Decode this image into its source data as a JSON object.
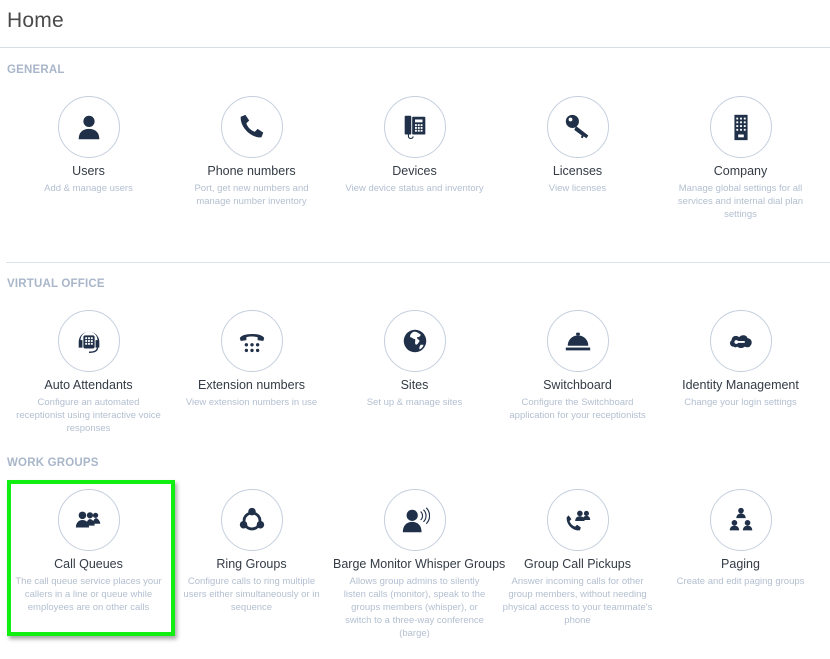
{
  "header": {
    "title": "Home"
  },
  "sections": [
    {
      "label": "GENERAL",
      "items": [
        {
          "title": "Users",
          "description": "Add & manage users",
          "icon": "user-icon"
        },
        {
          "title": "Phone numbers",
          "description": "Port, get new numbers and manage number inventory",
          "icon": "phone-icon"
        },
        {
          "title": "Devices",
          "description": "View device status and inventory",
          "icon": "desk-phone-icon"
        },
        {
          "title": "Licenses",
          "description": "View licenses",
          "icon": "key-icon"
        },
        {
          "title": "Company",
          "description": "Manage global settings for all services and internal dial plan settings",
          "icon": "building-icon"
        }
      ]
    },
    {
      "label": "VIRTUAL OFFICE",
      "items": [
        {
          "title": "Auto Attendants",
          "description": "Configure an automated receptionist using interactive voice responses",
          "icon": "headset-icon"
        },
        {
          "title": "Extension numbers",
          "description": "View extension numbers in use",
          "icon": "keypad-phone-icon"
        },
        {
          "title": "Sites",
          "description": "Set up & manage sites",
          "icon": "globe-icon"
        },
        {
          "title": "Switchboard",
          "description": "Configure the Switchboard application for your receptionists",
          "icon": "service-bell-icon"
        },
        {
          "title": "Identity Management",
          "description": "Change your login settings",
          "icon": "cloud-key-icon"
        }
      ]
    },
    {
      "label": "WORK GROUPS",
      "items": [
        {
          "title": "Call Queues",
          "description": "The call queue service places your callers in a line or queue while employees are on other calls",
          "icon": "user-group-icon",
          "highlighted": true
        },
        {
          "title": "Ring Groups",
          "description": "Configure calls to ring multiple users either simultaneously or in sequence",
          "icon": "ring-group-icon"
        },
        {
          "title": "Barge Monitor Whisper Groups",
          "description": "Allows group admins to silently listen calls (monitor), speak to the groups members (whisper), or switch to a three-way conference (barge)",
          "icon": "user-speaking-icon"
        },
        {
          "title": "Group Call Pickups",
          "description": "Answer incoming calls for other group members, without needing physical access to your teammate's phone",
          "icon": "phone-group-icon"
        },
        {
          "title": "Paging",
          "description": "Create and edit paging groups",
          "icon": "user-hierarchy-icon"
        }
      ]
    }
  ],
  "colors": {
    "highlight": "#11ee11",
    "icon": "#1f3048",
    "section_label": "#a9b6ca",
    "description": "#b3bfd0"
  }
}
